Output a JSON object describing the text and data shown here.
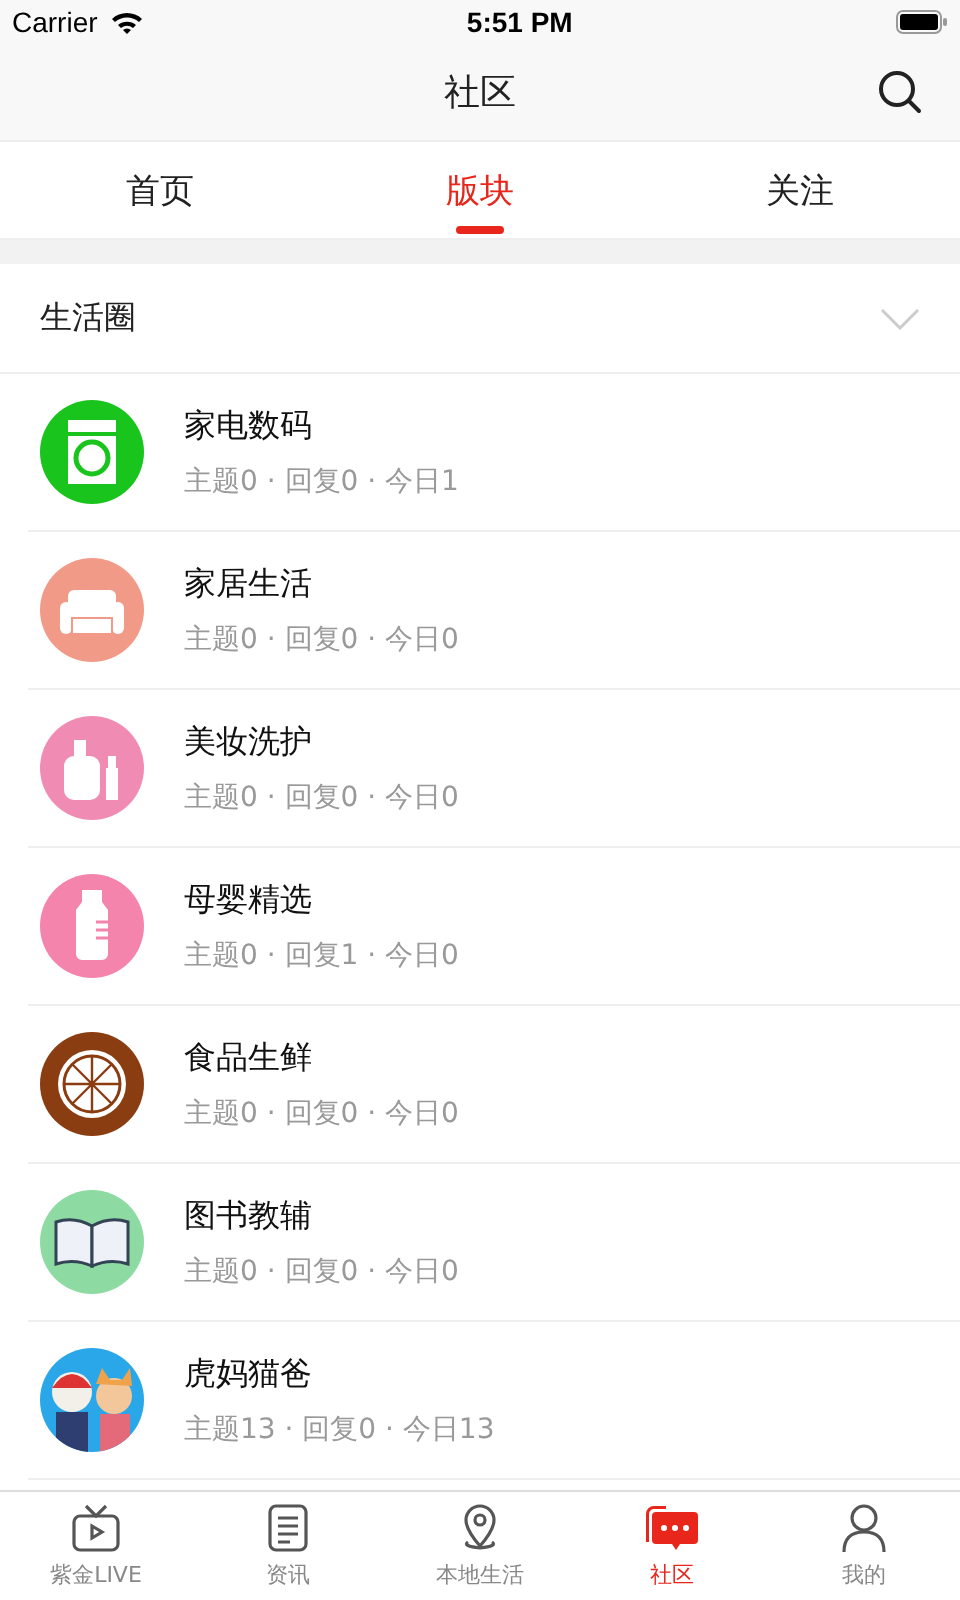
{
  "status_bar": {
    "carrier": "Carrier",
    "time": "5:51 PM"
  },
  "nav": {
    "title": "社区"
  },
  "tabs": [
    {
      "label": "首页",
      "selected": false
    },
    {
      "label": "版块",
      "selected": true
    },
    {
      "label": "关注",
      "selected": false
    }
  ],
  "section": {
    "title": "生活圈",
    "expanded": false
  },
  "forums": [
    {
      "name": "家电数码",
      "stats": "主题0 · 回复0 · 今日1",
      "kind": "washer"
    },
    {
      "name": "家居生活",
      "stats": "主题0 · 回复0 · 今日0",
      "kind": "sofa"
    },
    {
      "name": "美妆洗护",
      "stats": "主题0 · 回复0 · 今日0",
      "kind": "cosmetics"
    },
    {
      "name": "母婴精选",
      "stats": "主题0 · 回复1 · 今日0",
      "kind": "bottle"
    },
    {
      "name": "食品生鲜",
      "stats": "主题0 · 回复0 · 今日0",
      "kind": "orange"
    },
    {
      "name": "图书教辅",
      "stats": "主题0 · 回复0 · 今日0",
      "kind": "book"
    },
    {
      "name": "虎妈猫爸",
      "stats": "主题13 · 回复0 · 今日13",
      "kind": "picture"
    }
  ],
  "tab_bar": [
    {
      "label": "紫金LIVE",
      "kind": "tv",
      "selected": false
    },
    {
      "label": "资讯",
      "kind": "news",
      "selected": false
    },
    {
      "label": "本地生活",
      "kind": "pin",
      "selected": false
    },
    {
      "label": "社区",
      "kind": "chat",
      "selected": true
    },
    {
      "label": "我的",
      "kind": "person",
      "selected": false
    }
  ]
}
